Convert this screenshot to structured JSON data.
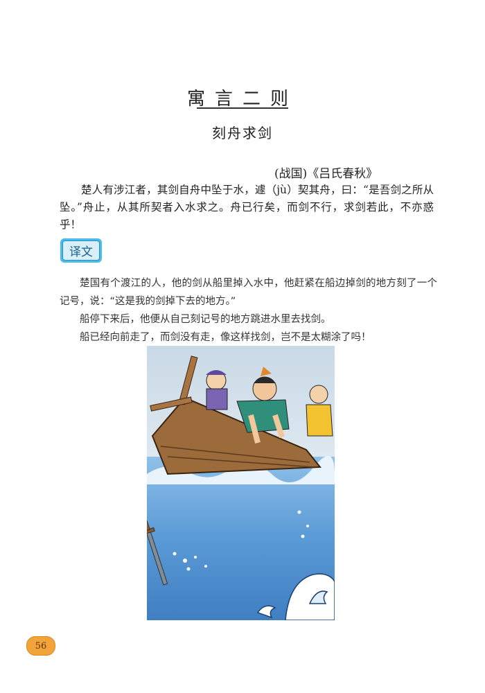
{
  "header": {
    "title": "寓言二则",
    "subtitle": "刻舟求剑",
    "source": "(战国)《吕氏春秋》"
  },
  "original": {
    "text": "楚人有涉江者，其剑自舟中坠于水，遽（jù）契其舟，曰：“是吾剑之所从坠。”舟止，从其所契者入水求之。舟已行矣，而剑不行，求剑若此，不亦惑乎！"
  },
  "translation": {
    "badge_label": "译文",
    "paragraphs": [
      "楚国有个渡江的人，他的剑从船里掉入水中，他赶紧在船边掉剑的地方刻了一个记号，说：“这是我的剑掉下去的地方。”",
      "船停下来后，他便从自己刻记号的地方跳进水里去找剑。",
      "船已经向前走了，而剑没有走，像这样找剑，岂不是太糊涂了吗！"
    ]
  },
  "footer": {
    "page_number": "56"
  },
  "colors": {
    "badge_blue": "#4bbce8",
    "page_badge_orange": "#f2a43a",
    "water_blue": "#4a8fd0",
    "boat_brown": "#9c6b3c"
  }
}
